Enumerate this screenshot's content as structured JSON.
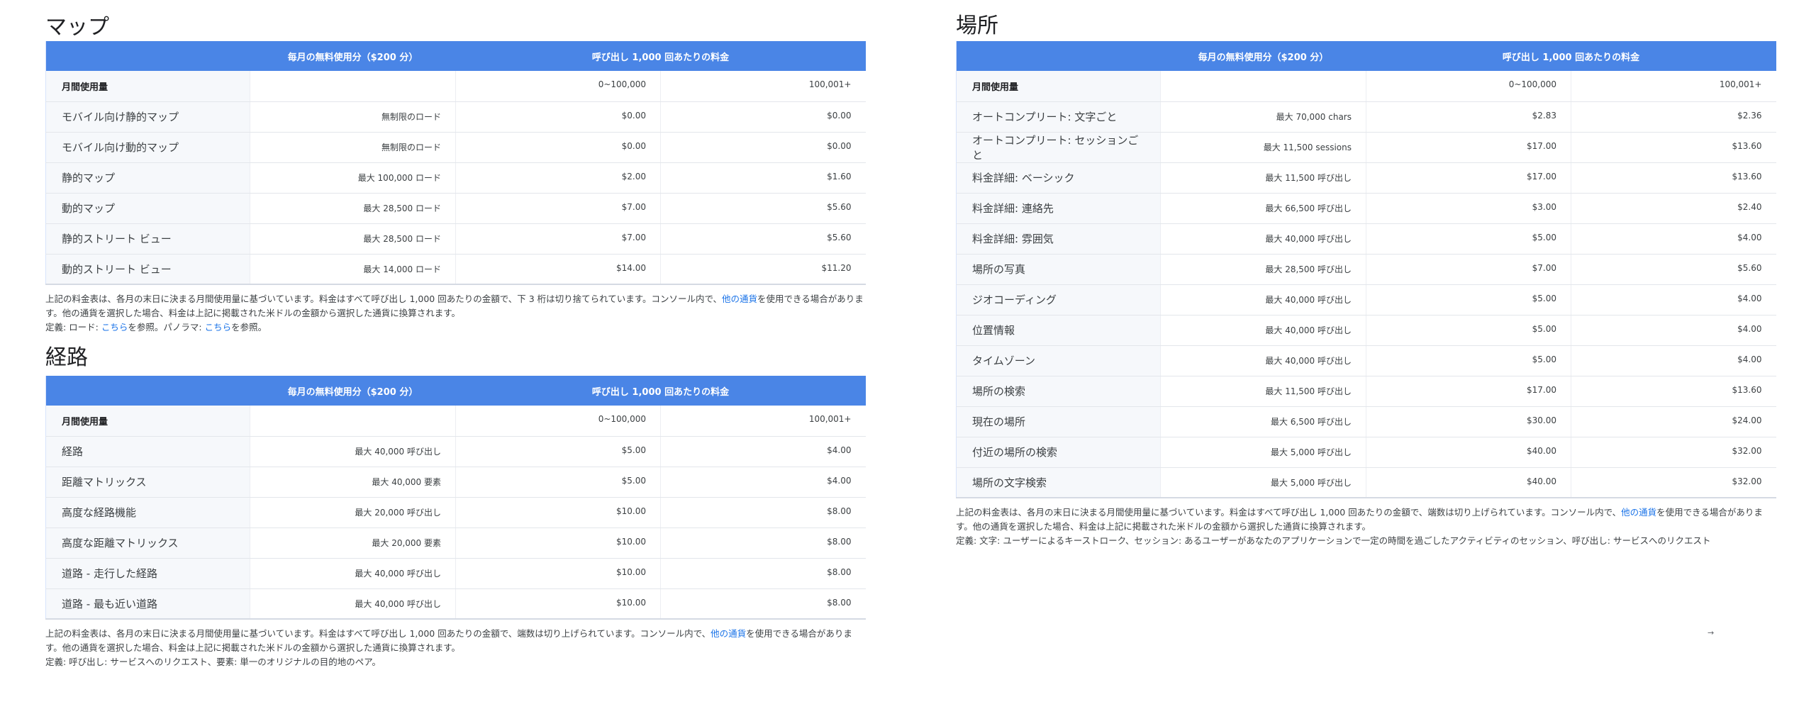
{
  "columns": {
    "header_free": "毎月の無料使用分（$200 分）",
    "header_price": "呼び出し 1,000 回あたりの料金"
  },
  "maps": {
    "title": "マップ",
    "usage": {
      "label": "月間使用量",
      "free": "",
      "tier1": "0~100,000",
      "tier2": "100,001+"
    },
    "rows": [
      {
        "label": "モバイル向け静的マップ",
        "free": "無制限のロード",
        "tier1": "$0.00",
        "tier2": "$0.00"
      },
      {
        "label": "モバイル向け動的マップ",
        "free": "無制限のロード",
        "tier1": "$0.00",
        "tier2": "$0.00"
      },
      {
        "label": "静的マップ",
        "free": "最大 100,000 ロード",
        "tier1": "$2.00",
        "tier2": "$1.60"
      },
      {
        "label": "動的マップ",
        "free": "最大 28,500 ロード",
        "tier1": "$7.00",
        "tier2": "$5.60"
      },
      {
        "label": "静的ストリート ビュー",
        "free": "最大 28,500 ロード",
        "tier1": "$7.00",
        "tier2": "$5.60"
      },
      {
        "label": "動的ストリート ビュー",
        "free": "最大 14,000 ロード",
        "tier1": "$14.00",
        "tier2": "$11.20"
      }
    ],
    "note_part1": "上記の料金表は、各月の末日に決まる月間使用量に基づいています。料金はすべて呼び出し 1,000 回あたりの金額で、下 3 桁は切り捨てられています。コンソール内で、",
    "note_link": "他の通貨",
    "note_part2": "を使用できる場合があります。他の通貨を選択した場合、料金は上記に掲載された米ドルの金額から選択した通貨に換算されます。",
    "def_part1": "定義: ロード: ",
    "def_link1": "こちら",
    "def_part2": "を参照。パノラマ: ",
    "def_link2": "こちら",
    "def_part3": "を参照。"
  },
  "routes": {
    "title": "経路",
    "usage": {
      "label": "月間使用量",
      "free": "",
      "tier1": "0~100,000",
      "tier2": "100,001+"
    },
    "rows": [
      {
        "label": "経路",
        "free": "最大 40,000 呼び出し",
        "tier1": "$5.00",
        "tier2": "$4.00"
      },
      {
        "label": "距離マトリックス",
        "free": "最大 40,000 要素",
        "tier1": "$5.00",
        "tier2": "$4.00"
      },
      {
        "label": "高度な経路機能",
        "free": "最大 20,000 呼び出し",
        "tier1": "$10.00",
        "tier2": "$8.00"
      },
      {
        "label": "高度な距離マトリックス",
        "free": "最大 20,000 要素",
        "tier1": "$10.00",
        "tier2": "$8.00"
      },
      {
        "label": "道路 - 走行した経路",
        "free": "最大 40,000 呼び出し",
        "tier1": "$10.00",
        "tier2": "$8.00"
      },
      {
        "label": "道路 - 最も近い道路",
        "free": "最大 40,000 呼び出し",
        "tier1": "$10.00",
        "tier2": "$8.00"
      }
    ],
    "note_part1": "上記の料金表は、各月の末日に決まる月間使用量に基づいています。料金はすべて呼び出し 1,000 回あたりの金額で、端数は切り上げられています。コンソール内で、",
    "note_link": "他の通貨",
    "note_part2": "を使用できる場合があります。他の通貨を選択した場合、料金は上記に掲載された米ドルの金額から選択した通貨に換算されます。",
    "definition": "定義: 呼び出し: サービスへのリクエスト、要素: 単一のオリジナルの目的地のペア。"
  },
  "places": {
    "title": "場所",
    "usage": {
      "label": "月間使用量",
      "free": "",
      "tier1": "0~100,000",
      "tier2": "100,001+"
    },
    "rows": [
      {
        "label": "オートコンプリート: 文字ごと",
        "free": "最大 70,000 chars",
        "tier1": "$2.83",
        "tier2": "$2.36"
      },
      {
        "label": "オートコンプリート: セッションごと",
        "free": "最大 11,500 sessions",
        "tier1": "$17.00",
        "tier2": "$13.60"
      },
      {
        "label": "料金詳細: ベーシック",
        "free": "最大 11,500 呼び出し",
        "tier1": "$17.00",
        "tier2": "$13.60"
      },
      {
        "label": "料金詳細: 連絡先",
        "free": "最大 66,500 呼び出し",
        "tier1": "$3.00",
        "tier2": "$2.40"
      },
      {
        "label": "料金詳細: 雰囲気",
        "free": "最大 40,000 呼び出し",
        "tier1": "$5.00",
        "tier2": "$4.00"
      },
      {
        "label": "場所の写真",
        "free": "最大 28,500 呼び出し",
        "tier1": "$7.00",
        "tier2": "$5.60"
      },
      {
        "label": "ジオコーディング",
        "free": "最大 40,000 呼び出し",
        "tier1": "$5.00",
        "tier2": "$4.00"
      },
      {
        "label": "位置情報",
        "free": "最大 40,000 呼び出し",
        "tier1": "$5.00",
        "tier2": "$4.00"
      },
      {
        "label": "タイムゾーン",
        "free": "最大 40,000 呼び出し",
        "tier1": "$5.00",
        "tier2": "$4.00"
      },
      {
        "label": "場所の検索",
        "free": "最大 11,500 呼び出し",
        "tier1": "$17.00",
        "tier2": "$13.60"
      },
      {
        "label": "現在の場所",
        "free": "最大 6,500 呼び出し",
        "tier1": "$30.00",
        "tier2": "$24.00"
      },
      {
        "label": "付近の場所の検索",
        "free": "最大 5,000 呼び出し",
        "tier1": "$40.00",
        "tier2": "$32.00"
      },
      {
        "label": "場所の文字検索",
        "free": "最大 5,000 呼び出し",
        "tier1": "$40.00",
        "tier2": "$32.00"
      }
    ],
    "note_part1": "上記の料金表は、各月の末日に決まる月間使用量に基づいています。料金はすべて呼び出し 1,000 回あたりの金額で、端数は切り上げられています。コンソール内で、",
    "note_link": "他の通貨",
    "note_part2": "を使用できる場合があります。他の通貨を選択した場合、料金は上記に掲載された米ドルの金額から選択した通貨に換算されます。",
    "definition": "定義: 文字: ユーザーによるキーストローク、セッション: あるユーザーがあなたのアプリケーションで一定の時間を過ごしたアクティビティのセッション、呼び出し: サービスへのリクエスト"
  },
  "misc": {
    "arrow_glyph": "→"
  }
}
